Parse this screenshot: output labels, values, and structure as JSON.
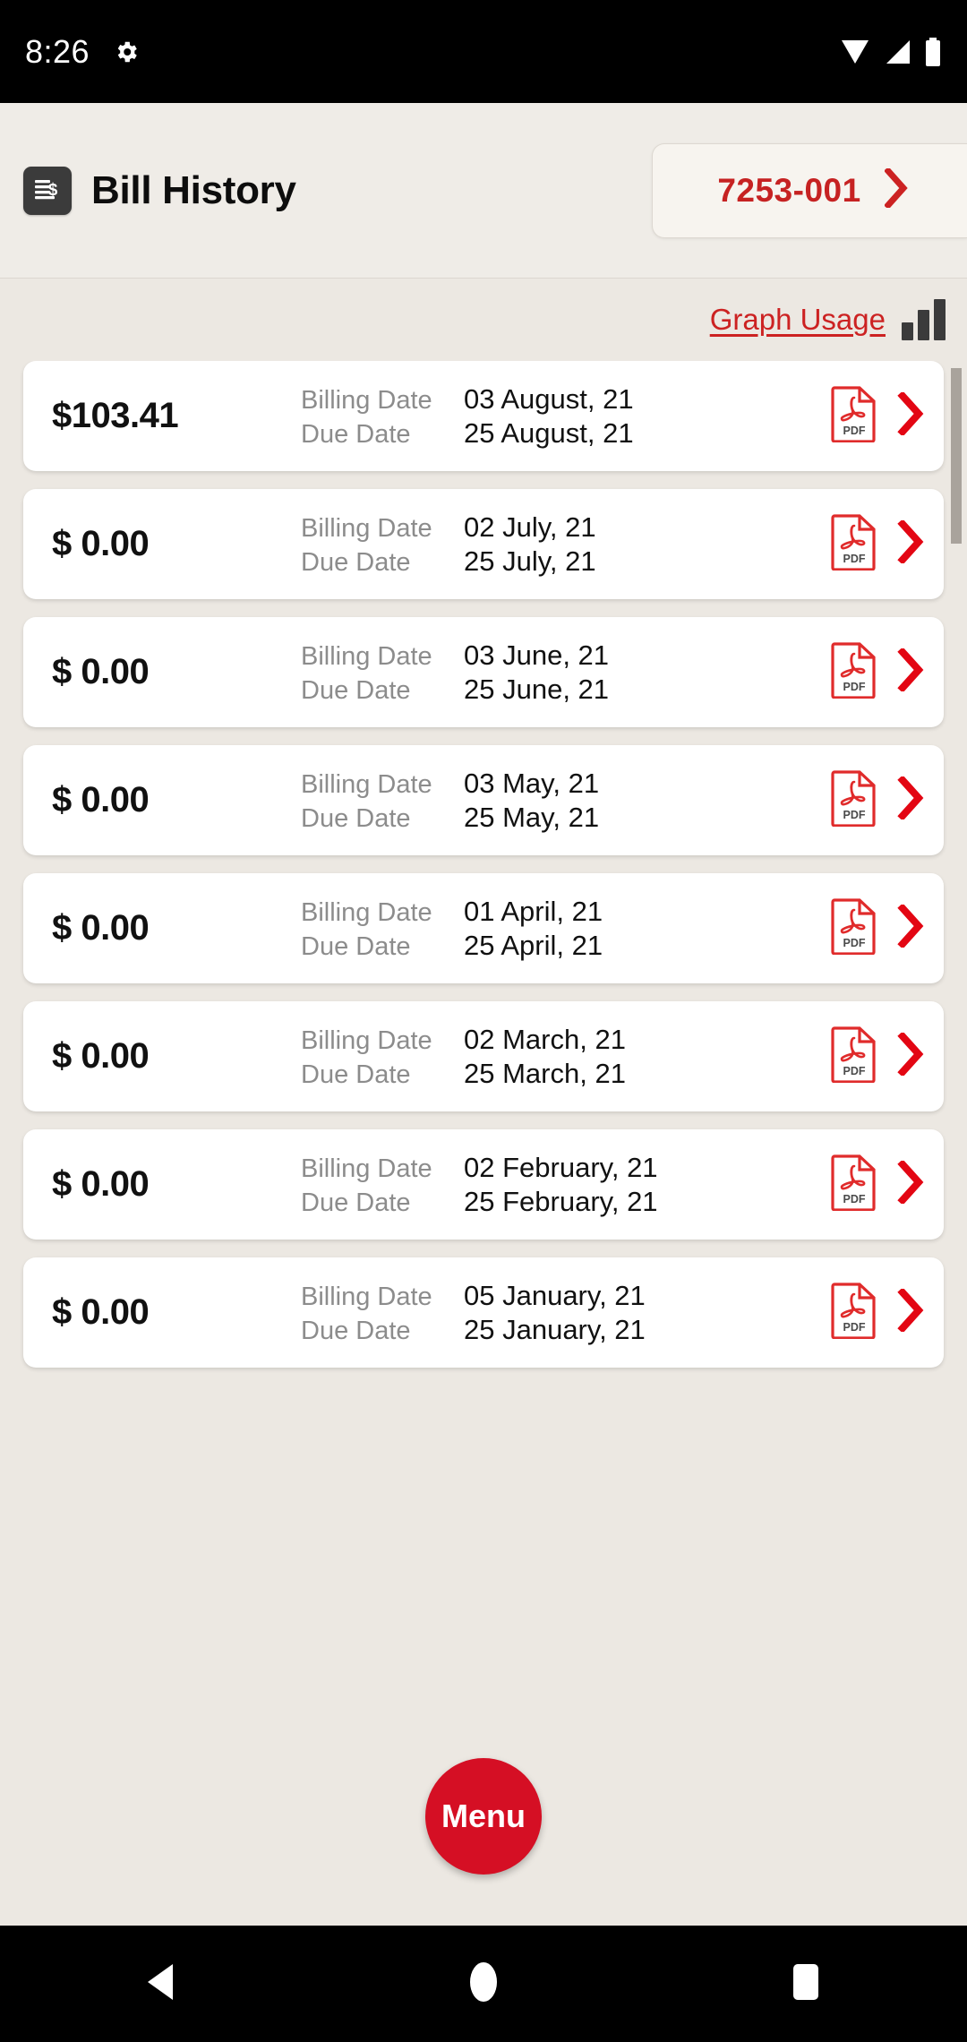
{
  "status_bar": {
    "time": "8:26",
    "left_icons": [
      "gear-icon"
    ],
    "right_icons": [
      "wifi-icon",
      "cellular-signal-icon",
      "battery-icon"
    ]
  },
  "header": {
    "icon": "bill-document-icon",
    "title": "Bill History",
    "account_button": {
      "label": "7253-001",
      "chevron": "chevron-right-icon"
    }
  },
  "toolbar": {
    "graph_usage_label": "Graph Usage",
    "graph_icon": "bar-chart-icon"
  },
  "list": {
    "labels": {
      "billing_date": "Billing Date",
      "due_date": "Due Date"
    },
    "row_icons": {
      "pdf": "pdf-file-icon",
      "pdf_text": "PDF",
      "chevron": "chevron-right-icon"
    },
    "bills": [
      {
        "amount": "$103.41",
        "billing_date": "03 August, 21",
        "due_date": "25 August, 21"
      },
      {
        "amount": "$ 0.00",
        "billing_date": "02 July, 21",
        "due_date": "25 July, 21"
      },
      {
        "amount": "$ 0.00",
        "billing_date": "03 June, 21",
        "due_date": "25 June, 21"
      },
      {
        "amount": "$ 0.00",
        "billing_date": "03 May, 21",
        "due_date": "25 May, 21"
      },
      {
        "amount": "$ 0.00",
        "billing_date": "01 April, 21",
        "due_date": "25 April, 21"
      },
      {
        "amount": "$ 0.00",
        "billing_date": "02 March, 21",
        "due_date": "25 March, 21"
      },
      {
        "amount": "$ 0.00",
        "billing_date": "02 February, 21",
        "due_date": "25 February, 21"
      },
      {
        "amount": "$ 0.00",
        "billing_date": "05 January, 21",
        "due_date": "25 January, 21"
      }
    ]
  },
  "fab": {
    "label": "Menu"
  },
  "nav_bar": {
    "back": "back-triangle-icon",
    "home": "home-circle-icon",
    "recents": "recents-square-icon"
  },
  "colors": {
    "accent_red": "#cc2222",
    "fab_red": "#d50f24",
    "page_bg": "#ece8e2",
    "header_bg": "#efece7",
    "card_bg": "#ffffff",
    "muted_text": "#8c8c8c"
  }
}
